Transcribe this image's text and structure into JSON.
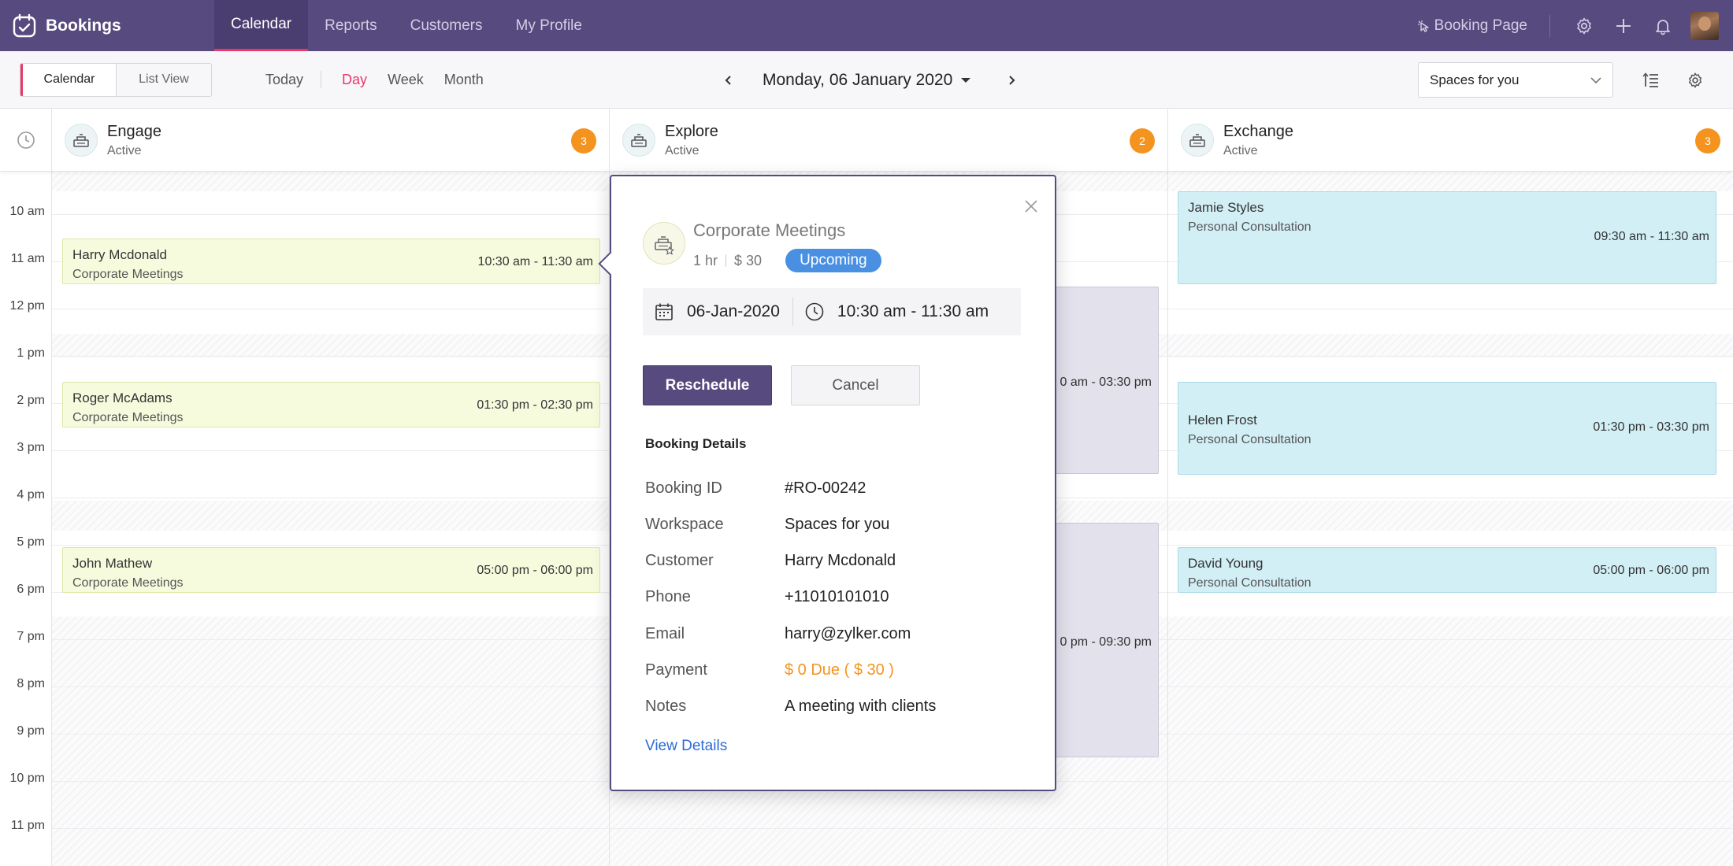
{
  "app": {
    "title": "Bookings"
  },
  "nav": {
    "tabs": [
      {
        "label": "Calendar"
      },
      {
        "label": "Reports"
      },
      {
        "label": "Customers"
      },
      {
        "label": "My Profile"
      }
    ],
    "booking_page_label": "Booking Page",
    "active_tab": "Calendar"
  },
  "toolbar": {
    "view_calendar": "Calendar",
    "view_list": "List View",
    "today": "Today",
    "ranges": [
      {
        "label": "Day"
      },
      {
        "label": "Week"
      },
      {
        "label": "Month"
      }
    ],
    "active_range": "Day",
    "date": "Monday, 06 January 2020",
    "workspace": "Spaces for you"
  },
  "resources": [
    {
      "name": "Engage",
      "status": "Active",
      "count": "3"
    },
    {
      "name": "Explore",
      "status": "Active",
      "count": "2"
    },
    {
      "name": "Exchange",
      "status": "Active",
      "count": "3"
    }
  ],
  "time_labels": [
    "10 am",
    "11 am",
    "12 pm",
    "1 pm",
    "2 pm",
    "3 pm",
    "4 pm",
    "5 pm",
    "6 pm",
    "7 pm",
    "8 pm",
    "9 pm",
    "10 pm",
    "11 pm"
  ],
  "events": {
    "engage": [
      {
        "name": "Harry Mcdonald",
        "service": "Corporate Meetings",
        "time": "10:30 am - 11:30 am"
      },
      {
        "name": "Roger McAdams",
        "service": "Corporate Meetings",
        "time": "01:30 pm - 02:30 pm"
      },
      {
        "name": "John Mathew",
        "service": "Corporate Meetings",
        "time": "05:00 pm - 06:00 pm"
      }
    ],
    "explore": [
      {
        "time_partial": "0 am - 03:30 pm"
      },
      {
        "time_partial": "0 pm - 09:30 pm"
      }
    ],
    "exchange": [
      {
        "name": "Jamie Styles",
        "service": "Personal Consultation",
        "time": "09:30 am - 11:30 am"
      },
      {
        "name": "Helen Frost",
        "service": "Personal Consultation",
        "time": "01:30 pm - 03:30 pm"
      },
      {
        "name": "David Young",
        "service": "Personal Consultation",
        "time": "05:00 pm - 06:00 pm"
      }
    ]
  },
  "popover": {
    "service": "Corporate Meetings",
    "duration": "1 hr",
    "price": "$ 30",
    "status": "Upcoming",
    "date": "06-Jan-2020",
    "time": "10:30 am - 11:30 am",
    "reschedule": "Reschedule",
    "cancel": "Cancel",
    "details_heading": "Booking Details",
    "details": [
      {
        "label": "Booking ID",
        "value": "#RO-00242"
      },
      {
        "label": "Workspace",
        "value": "Spaces for you"
      },
      {
        "label": "Customer",
        "value": "Harry Mcdonald"
      },
      {
        "label": "Phone",
        "value": "+11010101010"
      },
      {
        "label": "Email",
        "value": "harry@zylker.com"
      },
      {
        "label": "Payment",
        "value": "$ 0 Due ( $ 30 )"
      },
      {
        "label": "Notes",
        "value": "A meeting with clients"
      }
    ],
    "view_details": "View Details"
  },
  "colors": {
    "nav_bg": "#574a7e",
    "accent_pink": "#e8386a",
    "badge_orange": "#f5931f",
    "status_blue": "#4a90e2",
    "event_yellow": "#f7fbde",
    "event_blue": "#d2eff5",
    "event_grey": "#e3e1ec",
    "link_blue": "#2d6ad6"
  }
}
